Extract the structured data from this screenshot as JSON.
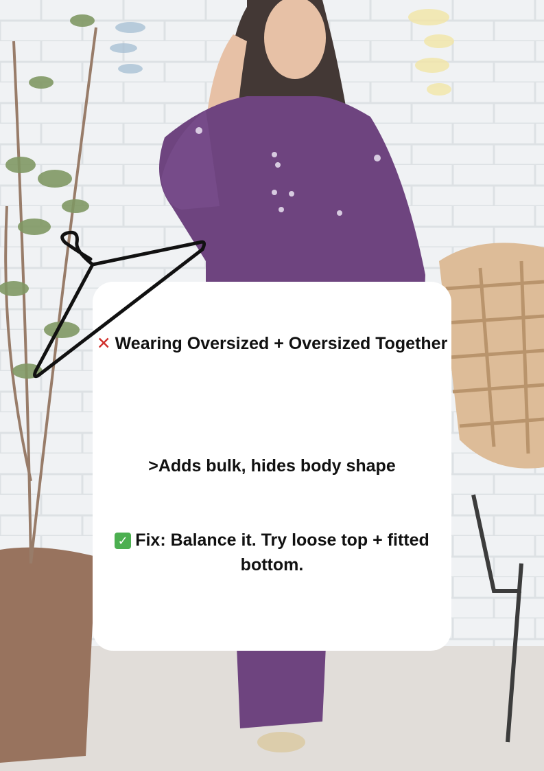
{
  "card": {
    "headline": "Wearing Oversized + Oversized Together",
    "headline_icon": "cross-mark-icon",
    "problem": ">Adds bulk, hides body shape",
    "fix": "Fix: Balance it. Try loose top + fitted bottom.",
    "fix_icon": "check-mark-icon"
  },
  "colors": {
    "card_background": "#ffffff",
    "outfit": "#5a2b6e",
    "cross_mark": "#d0312d",
    "check_mark": "#4caf50"
  },
  "icons": {
    "hanger": "clothes-hanger-icon"
  }
}
